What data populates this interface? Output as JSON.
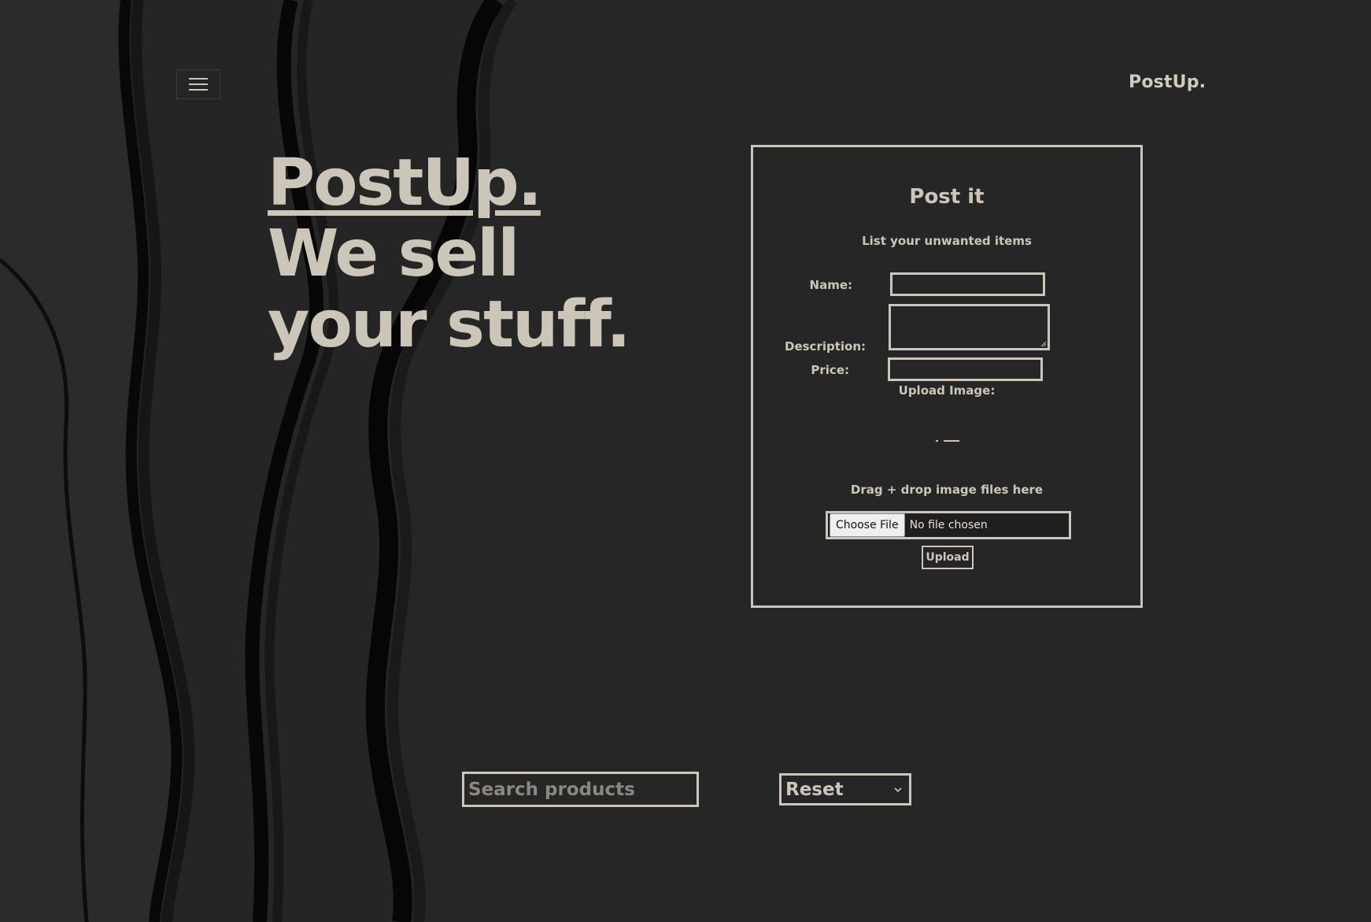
{
  "header": {
    "menu_icon": "hamburger-menu-icon",
    "brand": "PostUp."
  },
  "hero": {
    "brand_link": "PostUp.",
    "line2": "We sell",
    "line3": "your stuff."
  },
  "post_form": {
    "title": "Post it",
    "subtitle": "List your unwanted items",
    "name_label": "Name:",
    "name_value": "",
    "description_label": "Description:",
    "description_value": "",
    "price_label": "Price:",
    "price_value": "",
    "upload_image_label": "Upload Image:",
    "drop_icon": "upload-icon",
    "drop_text": "Drag + drop image files here",
    "choose_file_label": "Choose File",
    "file_status": "No file chosen",
    "upload_button": "Upload"
  },
  "filters": {
    "search_placeholder": "Search products",
    "search_value": "",
    "sort_selected": "Reset",
    "sort_icon": "chevron-down-icon"
  },
  "colors": {
    "background": "#242424",
    "accent": "#cbc6b8"
  }
}
